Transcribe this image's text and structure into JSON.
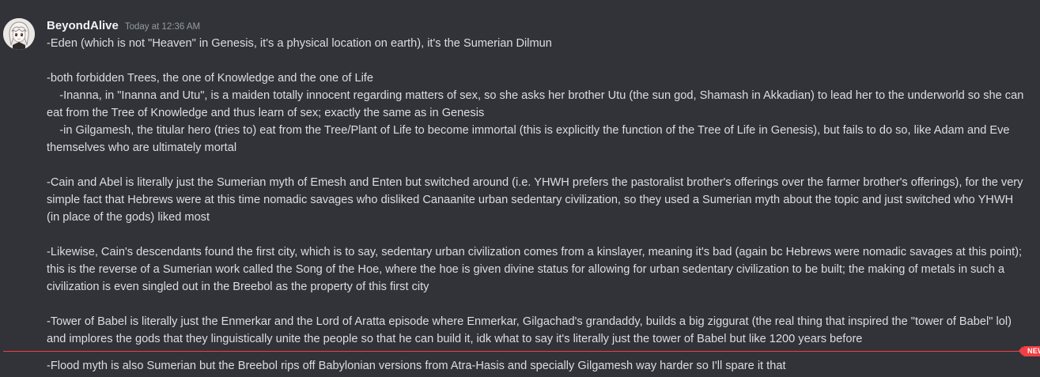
{
  "message": {
    "username": "BeyondAlive",
    "timestamp": "Today at 12:36 AM",
    "avatar_icon": "anime-character-avatar",
    "content": "-Eden (which is not \"Heaven\" in Genesis, it's a physical location on earth), it's the Sumerian Dilmun\n\n-both forbidden Trees, the one of Knowledge and the one of Life\n    -Inanna, in \"Inanna and Utu\", is a maiden totally innocent regarding matters of sex, so she asks her brother Utu (the sun god, Shamash in Akkadian) to lead her to the underworld so she can eat from the Tree of Knowledge and thus learn of sex; exactly the same as in Genesis\n    -in Gilgamesh, the titular hero (tries to) eat from the Tree/Plant of Life to become immortal (this is explicitly the function of the Tree of Life in Genesis), but fails to do so, like Adam and Eve themselves who are ultimately mortal\n\n-Cain and Abel is literally just the Sumerian myth of Emesh and Enten but switched around (i.e. YHWH prefers the pastoralist brother's offerings over the farmer brother's offerings), for the very simple fact that Hebrews were at this time nomadic savages who disliked Canaanite urban sedentary civilization, so they used a Sumerian myth about the topic and just switched who YHWH (in place of the gods) liked most\n\n-Likewise, Cain's descendants found the first city, which is to say, sedentary urban civilization comes from a kinslayer, meaning it's bad (again bc Hebrews were nomadic savages at this point); this is the reverse of a Sumerian work called the Song of the Hoe, where the hoe is given divine status for allowing for urban sedentary civilization to be built; the making of metals in such a civilization is even singled out in the Breebol as the property of this first city\n\n-Tower of Babel is literally just the Enmerkar and the Lord of Aratta episode where Enmerkar, Gilgachad's grandaddy, builds a big ziggurat (the real thing that inspired the \"tower of Babel\" lol) and implores the gods that they linguistically unite the people so that he can build it, idk what to say it's literally just the tower of Babel but like 1200 years before"
  },
  "divider": {
    "badge_label": "NEW",
    "color": "#f23f43"
  },
  "next_message": {
    "content": "-Flood myth is also Sumerian but the Breebol rips off Babylonian versions from Atra-Hasis and specially Gilgamesh way harder so I'll spare it that"
  },
  "colors": {
    "background": "#313338",
    "text": "#dbdee1",
    "username": "#f2f3f5",
    "timestamp": "#949ba4"
  }
}
